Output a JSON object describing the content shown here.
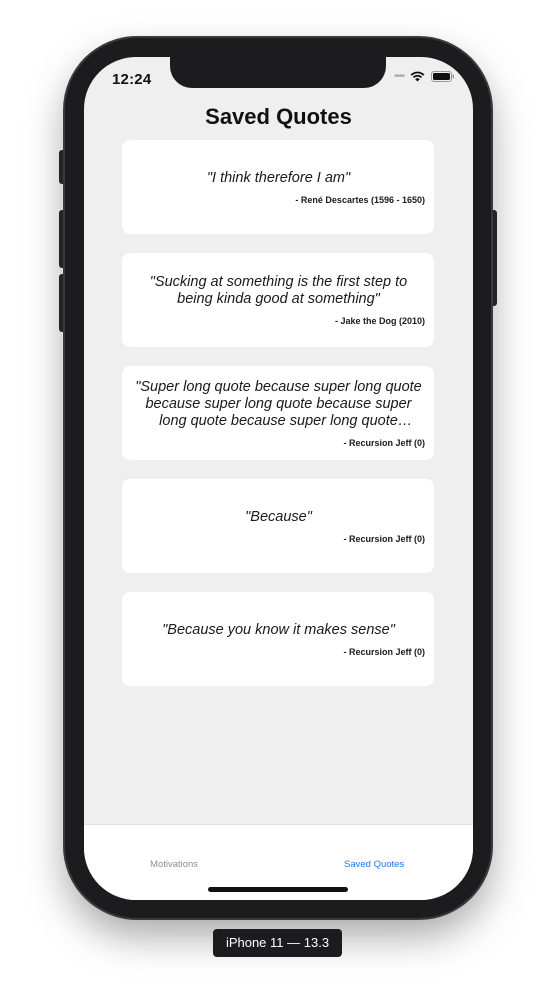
{
  "status_bar": {
    "time": "12:24",
    "signal_icon": "signal-dots-icon",
    "wifi_icon": "wifi-icon",
    "battery_icon": "battery-icon"
  },
  "header": {
    "title": "Saved Quotes"
  },
  "quotes": [
    {
      "text": "\"I think therefore I am\"",
      "author": "- René Descartes (1596 - 1650)"
    },
    {
      "text": "\"Sucking at something is the first step to being kinda good at something\"",
      "author": "- Jake the Dog (2010)"
    },
    {
      "text": "\"Super long quote because super long quote because super long quote because super long quote because super long quote because super long quote\"",
      "author": "- Recursion Jeff (0)"
    },
    {
      "text": "\"Because\"",
      "author": "- Recursion Jeff (0)"
    },
    {
      "text": "\"Because you know it makes sense\"",
      "author": "- Recursion Jeff (0)"
    }
  ],
  "tabbar": {
    "tabs": [
      {
        "label": "Motivations",
        "active": false
      },
      {
        "label": "Saved Quotes",
        "active": true
      }
    ],
    "active_color": "#1a7cf5",
    "inactive_color": "#8e8e93"
  },
  "device_label": "iPhone 11 — 13.3"
}
